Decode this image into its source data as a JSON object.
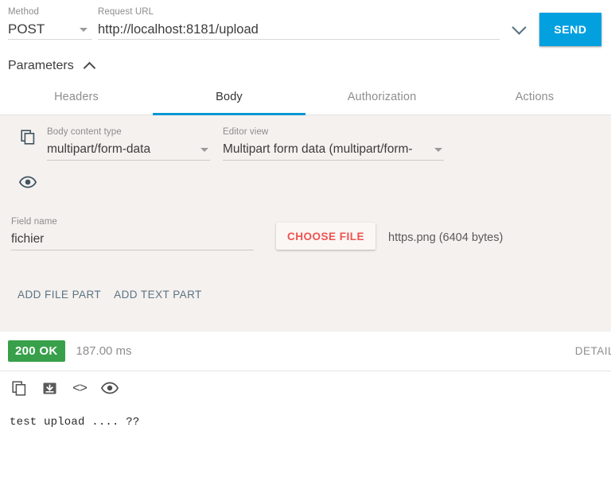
{
  "request": {
    "method_label": "Method",
    "method_value": "POST",
    "url_label": "Request URL",
    "url_value": "http://localhost:8181/upload",
    "history_icon": "chevron-down-icon",
    "send_label": "SEND"
  },
  "parameters": {
    "title": "Parameters",
    "collapse_icon": "chevron-up-icon"
  },
  "tabs": [
    {
      "label": "Headers",
      "active": false
    },
    {
      "label": "Body",
      "active": true
    },
    {
      "label": "Authorization",
      "active": false
    },
    {
      "label": "Actions",
      "active": false
    }
  ],
  "body_panel": {
    "copy_icon": "copy-icon",
    "content_type_label": "Body content type",
    "content_type_value": "multipart/form-data",
    "editor_view_label": "Editor view",
    "editor_view_value": "Multipart form data (multipart/form-",
    "preview_icon": "eye-icon",
    "field_name_label": "Field name",
    "field_name_value": "fichier",
    "choose_file_label": "CHOOSE FILE",
    "selected_file": "https.png (6404 bytes)",
    "add_file_part_label": "ADD FILE PART",
    "add_text_part_label": "ADD TEXT PART"
  },
  "response": {
    "status_code": "200 OK",
    "duration": "187.00 ms",
    "detail_label": "DETAIL",
    "toolbar_icons": [
      "copy-icon",
      "download-icon",
      "code-icon",
      "eye-icon"
    ],
    "code_glyph": "<>",
    "body_text": "test upload .... ??"
  },
  "colors": {
    "accent_blue": "#03a0e0",
    "tab_underline": "#0398d4",
    "status_green": "#38a04a",
    "choose_file_red": "#ef5350",
    "panel_bg": "#f5f1ef",
    "link_slate": "#5b7382"
  }
}
